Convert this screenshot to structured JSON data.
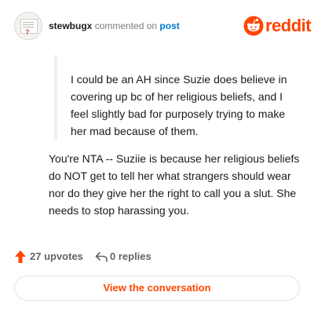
{
  "header": {
    "username": "stewbugx",
    "verb": "commented on",
    "target_link": "post",
    "brand": "reddit"
  },
  "comment": {
    "quote": "I could be an AH since Suzie does believe in covering up bc of her religious beliefs, and I feel slightly bad for purposely trying to make her mad because of them.",
    "body": "You're NTA -- Suziie is because her religious beliefs do NOT get to tell her what strangers should wear nor do they give her the right to call you a slut. She needs to stop harassing you."
  },
  "footer": {
    "upvotes": "27 upvotes",
    "replies": "0 replies",
    "view_button": "View the conversation"
  },
  "icons": {
    "avatar": "user-avatar-icon",
    "logo": "reddit-alien-icon",
    "upvote": "upvote-arrow-icon",
    "reply": "reply-arrow-icon"
  },
  "colors": {
    "brand": "#ff4500",
    "link": "#0079d3",
    "muted": "#7c7c7c",
    "text": "#1a1a1b"
  }
}
